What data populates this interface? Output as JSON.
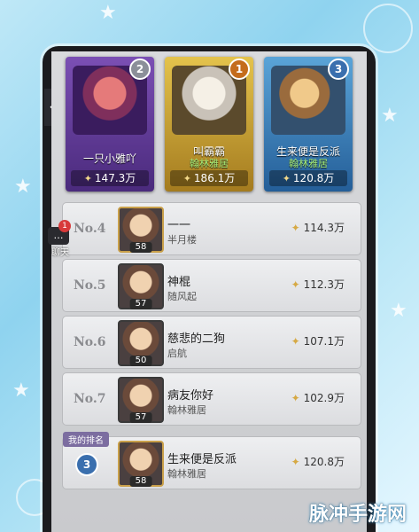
{
  "podium": [
    {
      "position_badge": "2",
      "name": "一只小雅吖",
      "guild": "",
      "power": "147.3万"
    },
    {
      "position_badge": "1",
      "name": "叫霸霸",
      "guild": "翰林雅居",
      "power": "186.1万"
    },
    {
      "position_badge": "3",
      "name": "生来便是反派",
      "guild": "翰林雅居",
      "power": "120.8万"
    }
  ],
  "rows": [
    {
      "rank": "No.4",
      "level": "58",
      "name": "一一",
      "guild": "半月楼",
      "power": "114.3万"
    },
    {
      "rank": "No.5",
      "level": "57",
      "name": "神棍",
      "guild": "随风起",
      "power": "112.3万"
    },
    {
      "rank": "No.6",
      "level": "50",
      "name": "慈悲的二狗",
      "guild": "启航",
      "power": "107.1万"
    },
    {
      "rank": "No.7",
      "level": "57",
      "name": "病友你好",
      "guild": "翰林雅居",
      "power": "102.9万"
    }
  ],
  "my_rank": {
    "tag": "我的排名",
    "badge": "3",
    "level": "58",
    "name": "生来便是反派",
    "guild": "翰林雅居",
    "power": "120.8万"
  },
  "chat": {
    "label": "聊天",
    "count": "1"
  },
  "power_icon": "winged-sword-icon",
  "watermark": "脉冲手游网"
}
